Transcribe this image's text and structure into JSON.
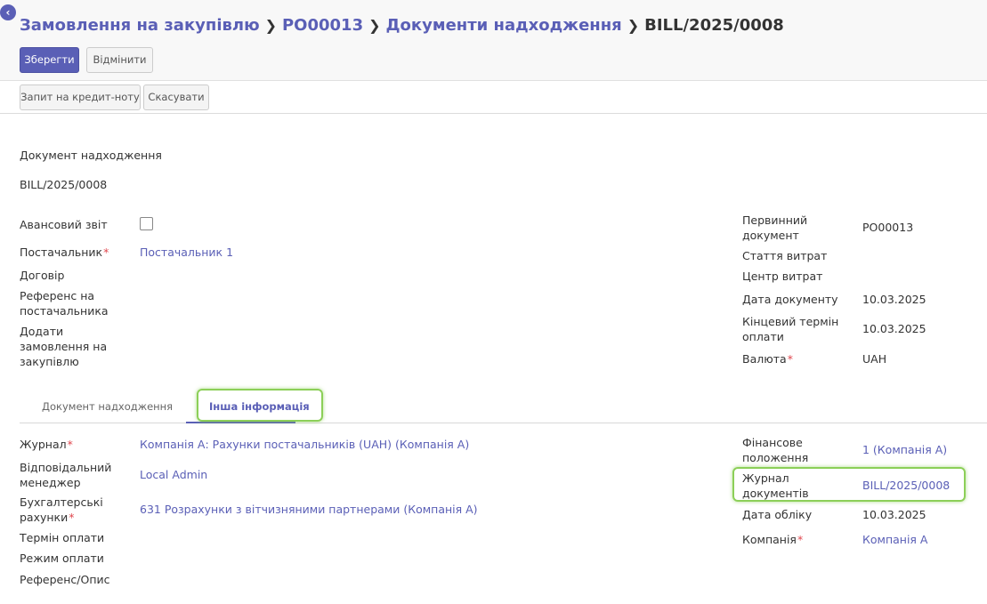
{
  "breadcrumb": {
    "item1": "Замовлення на закупівлю",
    "item2": "PO00013",
    "item3": "Документи надходження",
    "current": "BILL/2025/0008"
  },
  "toolbar": {
    "save_label": "Зберегти",
    "discard_label": "Відмінити"
  },
  "statusbar": {
    "credit_note_label": "Запит на кредит-ноту",
    "cancel_label": "Скасувати"
  },
  "header": {
    "doc_type": "Документ надходження",
    "doc_number": "BILL/2025/0008"
  },
  "left_fields": {
    "advance_report": "Авансовий звіт",
    "supplier_label": "Постачальник",
    "supplier_value": "Постачальник 1",
    "contract": "Договір",
    "supplier_ref_line1": "Референс на",
    "supplier_ref_line2": "постачальника",
    "add_po_line1": "Додати",
    "add_po_line2": "замовлення на",
    "add_po_line3": "закупівлю"
  },
  "right_fields": {
    "source_doc_line1": "Первинний",
    "source_doc_line2": "документ",
    "source_doc_value": "PO00013",
    "expense_item": "Стаття витрат",
    "cost_center": "Центр витрат",
    "doc_date_label": "Дата документу",
    "doc_date_value": "10.03.2025",
    "due_date_line1": "Кінцевий термін",
    "due_date_line2": "оплати",
    "due_date_value": "10.03.2025",
    "currency_label": "Валюта",
    "currency_value": "UAH"
  },
  "tabs": {
    "tab1": "Документ надходження",
    "tab2": "Інша інформація"
  },
  "other_info_left": {
    "journal_label": "Журнал",
    "journal_value": "Компанія А: Рахунки постачальників (UAH) (Компанія А)",
    "manager_line1": "Відповідальний",
    "manager_line2": "менеджер",
    "manager_value": "Local Admin",
    "accounts_line1": "Бухгалтерські",
    "accounts_line2": "рахунки",
    "accounts_value": "631 Розрахунки з вітчизняними партнерами (Компанія А)",
    "payment_term": "Термін оплати",
    "payment_mode": "Режим оплати",
    "reference": "Референс/Опис"
  },
  "other_info_right": {
    "fiscal_pos_line1": "Фінансове",
    "fiscal_pos_line2": "положення",
    "fiscal_pos_value": "1 (Компанія А)",
    "doc_journal_line1": "Журнал",
    "doc_journal_line2": "документів",
    "doc_journal_value": "BILL/2025/0008",
    "accounting_date_label": "Дата обліку",
    "accounting_date_value": "10.03.2025",
    "company_label": "Компанія",
    "company_value": "Компанія А"
  },
  "colors": {
    "accent": "#5a5fb6",
    "highlight": "#8ccf58",
    "required": "#e0474e"
  }
}
